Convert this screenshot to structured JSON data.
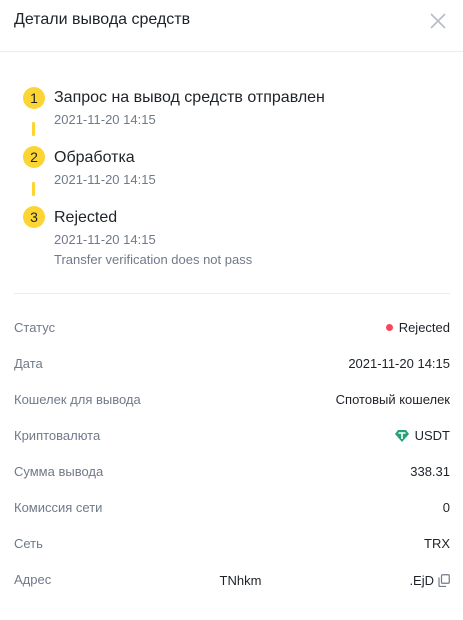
{
  "header": {
    "title": "Детали вывода средств"
  },
  "steps": [
    {
      "number": "1",
      "title": "Запрос на вывод средств отправлен",
      "time": "2021-11-20 14:15"
    },
    {
      "number": "2",
      "title": "Обработка",
      "time": "2021-11-20 14:15"
    },
    {
      "number": "3",
      "title": "Rejected",
      "time": "2021-11-20 14:15",
      "note": "Transfer verification does not pass"
    }
  ],
  "details": {
    "status": {
      "label": "Статус",
      "value": "Rejected",
      "color": "#f6465d"
    },
    "date": {
      "label": "Дата",
      "value": "2021-11-20 14:15"
    },
    "wallet": {
      "label": "Кошелек для вывода",
      "value": "Спотовый кошелек"
    },
    "crypto": {
      "label": "Криптовалюта",
      "value": "USDT",
      "icon": "tether-icon",
      "icon_color": "#26a17b"
    },
    "amount": {
      "label": "Сумма вывода",
      "value": "338.31"
    },
    "fee": {
      "label": "Комиссия сети",
      "value": "0"
    },
    "network": {
      "label": "Сеть",
      "value": "TRX"
    },
    "address": {
      "label": "Адрес",
      "value_start": "TNhkm",
      "value_end": ".EjD",
      "icon": "copy-icon"
    }
  },
  "colors": {
    "accent": "#fcd535",
    "muted": "#707a8a",
    "text": "#1e2329"
  }
}
